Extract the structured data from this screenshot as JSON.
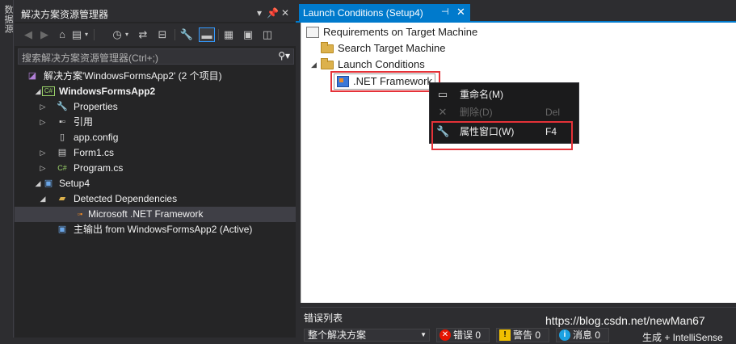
{
  "vertical_strip": {
    "label": "数据源"
  },
  "solution_explorer": {
    "title": "解决方案资源管理器",
    "title_buttons": [
      "▾",
      "📌",
      "✕"
    ],
    "search_placeholder": "搜索解决方案资源管理器(Ctrl+;)",
    "tree": [
      {
        "label": "解决方案'WindowsFormsApp2' (2 个项目)",
        "icon": "solution-icon",
        "arrow": ""
      },
      {
        "label": "WindowsFormsApp2",
        "icon": "csharp-project-icon",
        "arrow": "◢",
        "bold": true
      },
      {
        "label": "Properties",
        "icon": "wrench-icon",
        "arrow": "▷"
      },
      {
        "label": "引用",
        "icon": "references-icon",
        "arrow": "▷"
      },
      {
        "label": "app.config",
        "icon": "config-file-icon",
        "arrow": ""
      },
      {
        "label": "Form1.cs",
        "icon": "form-icon",
        "arrow": "▷"
      },
      {
        "label": "Program.cs",
        "icon": "csharp-file-icon",
        "arrow": "▷"
      },
      {
        "label": "Setup4",
        "icon": "setup-project-icon",
        "arrow": "◢"
      },
      {
        "label": "Detected Dependencies",
        "icon": "folder-open-icon",
        "arrow": "◢"
      },
      {
        "label": "Microsoft .NET Framework",
        "icon": "dependency-icon",
        "arrow": "",
        "selected": true
      },
      {
        "label": "主输出 from WindowsFormsApp2 (Active)",
        "icon": "primary-output-icon",
        "arrow": ""
      }
    ]
  },
  "editor": {
    "tab_title": "Launch Conditions (Setup4)",
    "tab_pin": "⊣",
    "tab_close": "✕",
    "tree": {
      "root": "Requirements on Target Machine",
      "search": "Search Target Machine",
      "launch": "Launch Conditions",
      "selected_item": ".NET Framework"
    }
  },
  "context_menu": {
    "items": [
      {
        "label": "重命名(M)",
        "shortcut": "",
        "icon": "rename-icon",
        "enabled": true
      },
      {
        "label": "删除(D)",
        "shortcut": "Del",
        "icon": "delete-icon",
        "enabled": false
      },
      {
        "label": "属性窗口(W)",
        "shortcut": "F4",
        "icon": "wrench-icon",
        "enabled": true
      }
    ]
  },
  "error_list": {
    "title": "错误列表",
    "scope": "整个解决方案",
    "errors_label": "错误 0",
    "warnings_label": "警告 0",
    "messages_label": "消息 0",
    "build_label": "生成 + IntelliSense"
  },
  "watermark": "https://blog.csdn.net/newMan67",
  "colors": {
    "accent": "#007acc",
    "highlight_box": "#e53238",
    "background_dark": "#2d2d30"
  }
}
